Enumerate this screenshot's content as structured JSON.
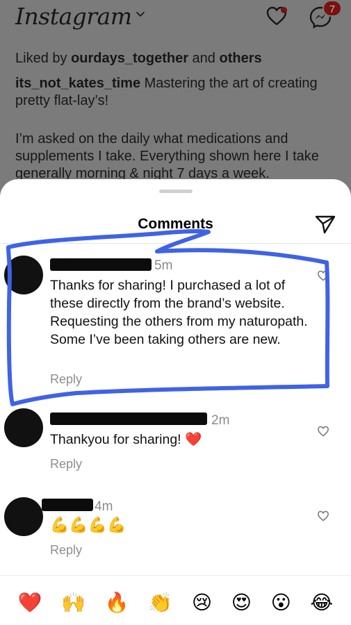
{
  "header": {
    "logo_text": "Instagram",
    "badge_count": "7"
  },
  "post": {
    "liked_prefix": "Liked by ",
    "liked_user": "ourdays_together",
    "liked_mid": " and ",
    "liked_others": "others",
    "caption_user": "its_not_kates_time",
    "caption_text": " Mastering the art of creating pretty flat-lay’s!",
    "caption_more": "I’m asked on the daily what medications and supplements I take. Everything shown here I take generally morning & night 7 days a week."
  },
  "sheet": {
    "title": "Comments"
  },
  "comments": [
    {
      "time": "5m",
      "text": "Thanks for sharing! I purchased a lot of these directly from the brand’s website. Requesting the others from my naturopath. Some I’ve been taking others are new.",
      "reply": "Reply"
    },
    {
      "time": "2m",
      "text": "Thankyou for sharing! ",
      "emoji": "❤️",
      "reply": "Reply"
    },
    {
      "time": "4m",
      "text": "💪💪💪💪",
      "reply": "Reply"
    }
  ],
  "quick_reactions": [
    "❤️",
    "🙌",
    "🔥",
    "👏",
    "😢",
    "😍",
    "😮",
    "😂"
  ],
  "colors": {
    "annotation_blue": "#3f63e6",
    "heart_red": "#e0245e"
  }
}
